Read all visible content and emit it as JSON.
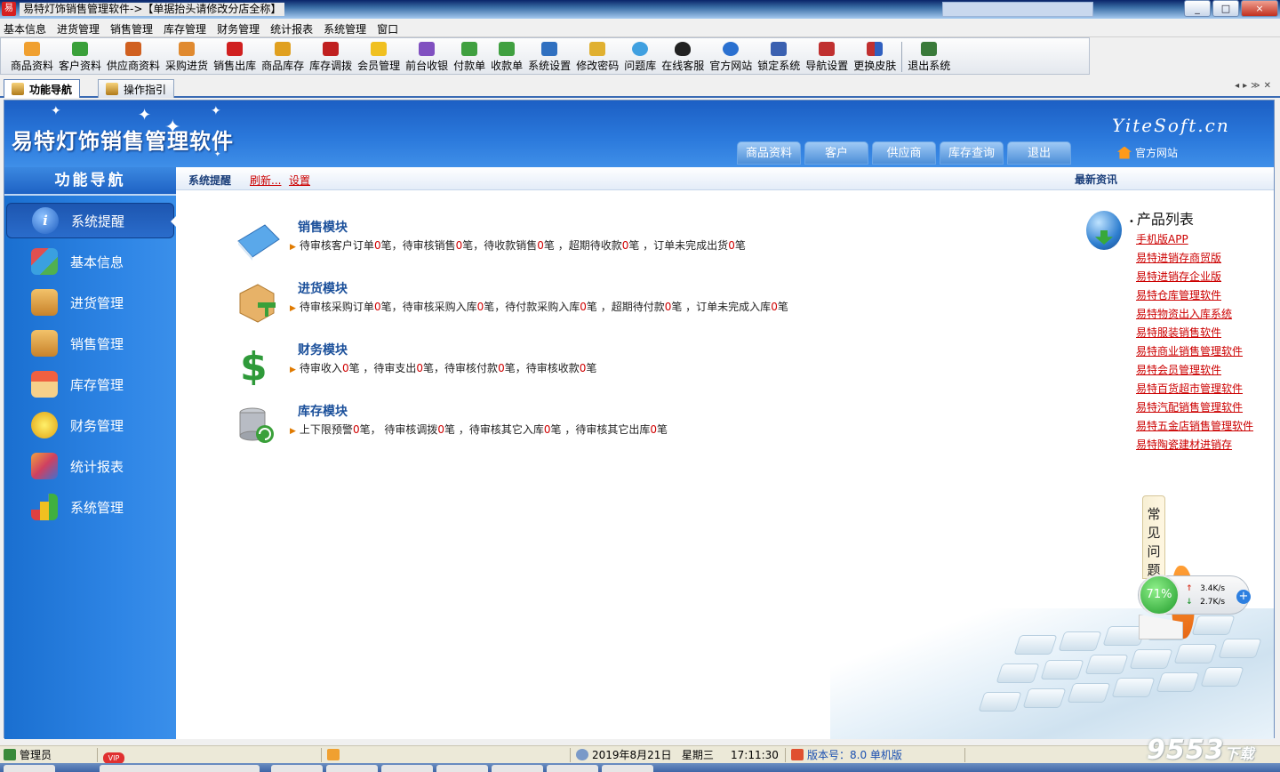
{
  "window": {
    "title": "易特灯饰销售管理软件->【单据抬头请修改分店全称】",
    "app_icon": "易",
    "buttons": {
      "minimize": "_",
      "maximize": "□",
      "close": "×"
    }
  },
  "menu": [
    "基本信息",
    "进货管理",
    "销售管理",
    "库存管理",
    "财务管理",
    "统计报表",
    "系统管理",
    "窗口"
  ],
  "toolbar": [
    {
      "label": "商品资料",
      "icon": "goods-icon",
      "color": "#f0a030"
    },
    {
      "label": "客户资料",
      "icon": "customer-icon",
      "color": "#3aa03a"
    },
    {
      "label": "供应商资料",
      "icon": "supplier-icon",
      "color": "#d06020"
    },
    {
      "label": "采购进货",
      "icon": "purchase-icon",
      "color": "#e08a30"
    },
    {
      "label": "销售出库",
      "icon": "sales-out-icon",
      "color": "#d02020"
    },
    {
      "label": "商品库存",
      "icon": "stock-icon",
      "color": "#e0a020"
    },
    {
      "label": "库存调拨",
      "icon": "transfer-icon",
      "color": "#c02020"
    },
    {
      "label": "会员管理",
      "icon": "member-icon",
      "color": "#f0c020"
    },
    {
      "label": "前台收银",
      "icon": "cashier-icon",
      "color": "#8050c0"
    },
    {
      "label": "付款单",
      "icon": "payment-icon",
      "color": "#40a040"
    },
    {
      "label": "收款单",
      "icon": "receipt-icon",
      "color": "#40a040"
    },
    {
      "label": "系统设置",
      "icon": "settings-icon",
      "color": "#3070c0"
    },
    {
      "label": "修改密码",
      "icon": "key-icon",
      "color": "#e0b030"
    },
    {
      "label": "问题库",
      "icon": "question-icon",
      "color": "#40a0e0"
    },
    {
      "label": "在线客服",
      "icon": "qq-icon",
      "color": "#222222"
    },
    {
      "label": "官方网站",
      "icon": "ie-icon",
      "color": "#2a70d0"
    },
    {
      "label": "锁定系统",
      "icon": "lock-screen-icon",
      "color": "#3a60b0"
    },
    {
      "label": "导航设置",
      "icon": "nav-settings-icon",
      "color": "#c03030"
    },
    {
      "label": "更换皮肤",
      "icon": "skin-icon",
      "color": "#9040c0"
    },
    {
      "label": "退出系统",
      "icon": "exit-icon",
      "color": "#3a7a3a"
    }
  ],
  "tabs": [
    {
      "label": "功能导航",
      "active": true
    },
    {
      "label": "操作指引",
      "active": false
    }
  ],
  "header": {
    "title": "易特灯饰销售管理软件",
    "brand": "YiteSoft.cn",
    "nav_buttons": [
      "商品资料",
      "客户",
      "供应商",
      "库存查询",
      "退出"
    ],
    "home_link": "官方网站"
  },
  "sidebar": {
    "heading": "功能导航",
    "items": [
      {
        "label": "系统提醒",
        "icon": "info-icon",
        "active": true
      },
      {
        "label": "基本信息",
        "icon": "cubes-icon",
        "active": false
      },
      {
        "label": "进货管理",
        "icon": "box-in-icon",
        "active": false
      },
      {
        "label": "销售管理",
        "icon": "box-out-icon",
        "active": false
      },
      {
        "label": "库存管理",
        "icon": "warehouse-icon",
        "active": false
      },
      {
        "label": "财务管理",
        "icon": "finance-icon",
        "active": false
      },
      {
        "label": "统计报表",
        "icon": "report-icon",
        "active": false
      },
      {
        "label": "系统管理",
        "icon": "bar-chart-icon",
        "active": false
      }
    ]
  },
  "subbar": {
    "title": "系统提醒",
    "refresh": "刷新...",
    "settings": "设置",
    "news": "最新资讯"
  },
  "modules": [
    {
      "title": "销售模块",
      "parts": [
        "待审核客户订单",
        "0",
        "笔，待审核销售",
        "0",
        "笔，待收款销售",
        "0",
        "笔 ，超期待收款",
        "0",
        "笔 ，订单未完成出货",
        "0",
        "笔"
      ]
    },
    {
      "title": "进货模块",
      "parts": [
        "待审核采购订单",
        "0",
        "笔，待审核采购入库",
        "0",
        "笔，待付款采购入库",
        "0",
        "笔 ，超期待付款",
        "0",
        "笔 ，订单未完成入库",
        "0",
        "笔"
      ]
    },
    {
      "title": "财务模块",
      "parts": [
        "待审收入",
        "0",
        "笔 ，待审支出",
        "0",
        "笔，待审核付款",
        "0",
        "笔，待审核收款",
        "0",
        "笔"
      ]
    },
    {
      "title": "库存模块",
      "parts": [
        "上下限预警",
        "0",
        "笔，  待审核调拨",
        "0",
        "笔 ，待审核其它入库",
        "0",
        "笔 ，待审核其它出库",
        "0",
        "笔"
      ]
    }
  ],
  "products": {
    "heading": "产品列表",
    "items": [
      "手机版APP",
      "易特进销存商贸版",
      "易特进销存企业版",
      "易特仓库管理软件",
      "易特物资出入库系统",
      "易特服装销售软件",
      "易特商业销售管理软件",
      "易特会员管理软件",
      "易特百货超市管理软件",
      "易特汽配销售管理软件",
      "易特五金店销售管理软件",
      "易特陶瓷建材进销存"
    ]
  },
  "faq": "常见问题",
  "speed_widget": {
    "percent": "71%",
    "upload": "3.4K/s",
    "download": "2.7K/s",
    "plus": "+"
  },
  "statusbar": {
    "user": "管理员",
    "vip": "VIP",
    "date": "2019年8月21日",
    "weekday": "星期三",
    "time": "17:11:30",
    "version": "版本号：8.0 单机版"
  },
  "watermark": {
    "main": "9553",
    "suffix": "下载"
  },
  "colors": {
    "accent": "#2a78db",
    "link": "#cc0000",
    "sidebar": "#1a6fd0"
  }
}
